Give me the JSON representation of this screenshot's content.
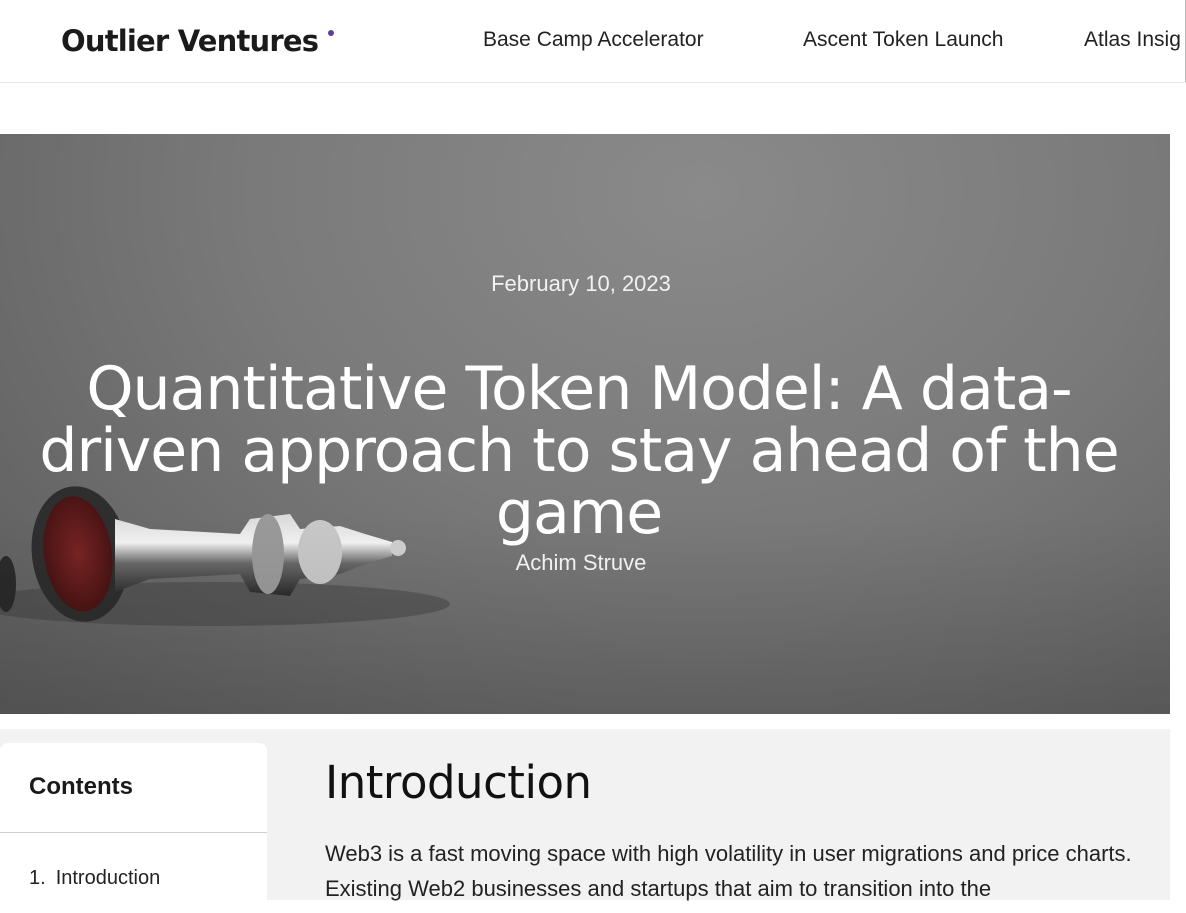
{
  "header": {
    "logo_text": "Outlier Ventures",
    "nav": [
      "Base Camp Accelerator",
      "Ascent Token Launch",
      "Atlas Insig"
    ]
  },
  "hero": {
    "date": "February 10, 2023",
    "title": "Quantitative Token Model: A data-driven approach to stay ahead of the game",
    "author": "Achim Struve"
  },
  "toc": {
    "title": "Contents",
    "items": [
      {
        "num": "1.",
        "label": "Introduction"
      }
    ]
  },
  "article": {
    "heading": "Introduction",
    "paragraph": "Web3 is a fast moving space with high volatility in user migrations and price charts. Existing Web2 businesses and startups that aim to transition into the"
  },
  "colors": {
    "logo_dot": "#5b3f9e",
    "content_bg": "#f2f2f2"
  }
}
